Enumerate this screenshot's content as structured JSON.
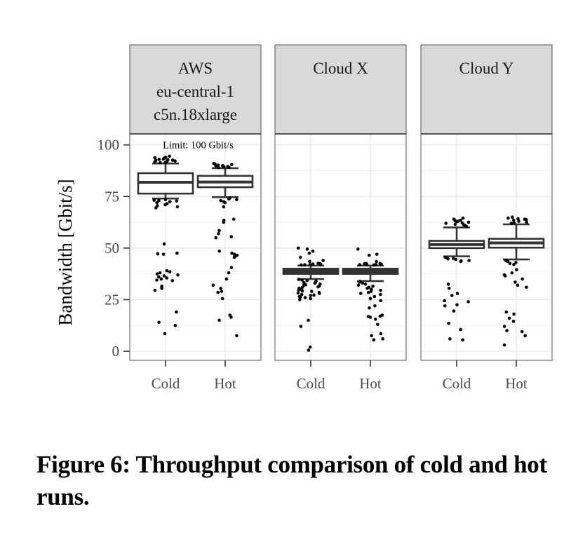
{
  "figure": {
    "caption": "Figure 6: Throughput comparison of cold and hot runs."
  },
  "chart_data": {
    "type": "boxplot",
    "title": "",
    "xlabel": "",
    "ylabel": "Bandwidth [Gbit/s]",
    "ylim": [
      0,
      100
    ],
    "yticks": [
      0,
      25,
      50,
      75,
      100
    ],
    "ytick_labels": [
      "0",
      "25",
      "50",
      "75",
      "100"
    ],
    "grid": true,
    "categories": [
      "Cold",
      "Hot"
    ],
    "annotations": [
      {
        "panel": 0,
        "text": "Limit: 100 Gbit/s",
        "y": 100
      }
    ],
    "panels": [
      {
        "strip_lines": [
          "AWS",
          "eu-central-1",
          "c5n.18xlarge"
        ],
        "series": [
          {
            "category": "Cold",
            "q1": 76.4,
            "median": 81.9,
            "q3": 86.3,
            "whisker_low": 74,
            "whisker_high": 91,
            "outliers": [
              91.5,
              92,
              92.5,
              93,
              93.5,
              94,
              91.8,
              92.2,
              92.8,
              93.2,
              91.4,
              92.6,
              94.5,
              93.8,
              73.5,
              73,
              72.5,
              72,
              71.5,
              71,
              70.5,
              73.2,
              72.8,
              70,
              69.5,
              52,
              47.5,
              47.2,
              47,
              39,
              38.5,
              38,
              37.5,
              37,
              36.5,
              36,
              35.5,
              35,
              34.5,
              34.2,
              31.5,
              30.5,
              29.5,
              19,
              14,
              12.5,
              8.5
            ]
          },
          {
            "category": "Hot",
            "q1": 79.5,
            "median": 82,
            "q3": 85,
            "whisker_low": 74.7,
            "whisker_high": 88.7,
            "outliers": [
              89,
              89.5,
              90,
              90.5,
              89.2,
              89.8,
              90.2,
              89.4,
              90.8,
              91,
              89.6,
              74.2,
              73.8,
              73.5,
              73,
              72.5,
              72,
              70,
              64,
              63.5,
              62.5,
              58.5,
              57,
              55.5,
              55,
              48.5,
              47.5,
              47,
              46.5,
              46.2,
              45.5,
              40.5,
              38,
              35,
              32,
              30.5,
              29,
              28.5,
              25.5,
              17.5,
              16.5,
              15,
              7.5
            ]
          }
        ]
      },
      {
        "strip_lines": [
          "Cloud X"
        ],
        "series": [
          {
            "category": "Cold",
            "q1": 37.5,
            "median": 38.5,
            "q3": 40,
            "whisker_low": 35,
            "whisker_high": 41.5,
            "outliers": [
              50,
              49.5,
              48.5,
              47.5,
              45.5,
              44,
              43.5,
              42.5,
              42.3,
              42,
              41.8,
              42.6,
              42.1,
              41.9,
              34.8,
              34.5,
              34,
              33.5,
              33,
              32.5,
              32,
              31.5,
              31,
              30.5,
              30,
              29.5,
              29,
              28.5,
              28,
              27.5,
              27,
              26.5,
              26,
              25.5,
              25,
              34.2,
              33.2,
              32.2,
              31.2,
              30.2,
              29.2,
              28.2,
              27.2,
              26.2,
              15,
              12,
              2,
              0.5
            ]
          },
          {
            "category": "Hot",
            "q1": 37.5,
            "median": 38.5,
            "q3": 40,
            "whisker_low": 34,
            "whisker_high": 41.5,
            "outliers": [
              49.5,
              47,
              46.5,
              43.5,
              42.5,
              42.2,
              42,
              41.8,
              42.4,
              42.1,
              41.9,
              42.6,
              33.8,
              33.5,
              33,
              32.5,
              32,
              31.5,
              31,
              30.5,
              30,
              29.5,
              29,
              28.5,
              28,
              27.5,
              26.5,
              25.5,
              24.5,
              22,
              21,
              17.5,
              17,
              16.8,
              16.5,
              15.5,
              13,
              8.5,
              7.5,
              6,
              5.5
            ]
          }
        ]
      },
      {
        "strip_lines": [
          "Cloud Y"
        ],
        "series": [
          {
            "category": "Cold",
            "q1": 50,
            "median": 51.7,
            "q3": 53.5,
            "whisker_low": 46,
            "whisker_high": 60,
            "outliers": [
              61,
              61.5,
              62,
              62.5,
              63,
              63.5,
              64,
              64.5,
              61.2,
              62.8,
              63.2,
              60.5,
              62.2,
              45.5,
              45,
              44.5,
              44,
              43.5,
              44.8,
              43.8,
              32.5,
              30.5,
              28,
              27,
              24.5,
              24,
              22.5,
              22,
              19.5,
              13.5,
              10.5,
              6,
              5.5
            ]
          },
          {
            "category": "Hot",
            "q1": 50.2,
            "median": 52.5,
            "q3": 54.5,
            "whisker_low": 44.5,
            "whisker_high": 61.5,
            "outliers": [
              62,
              62.5,
              63,
              63.5,
              64,
              64.5,
              65,
              62.2,
              63.8,
              64.2,
              44,
              43.5,
              43,
              42.5,
              42,
              39.5,
              38,
              37,
              36.5,
              35,
              33.5,
              32,
              31,
              19,
              18,
              16,
              14.5,
              12,
              10,
              9.5,
              7.5,
              3
            ]
          }
        ]
      }
    ]
  }
}
